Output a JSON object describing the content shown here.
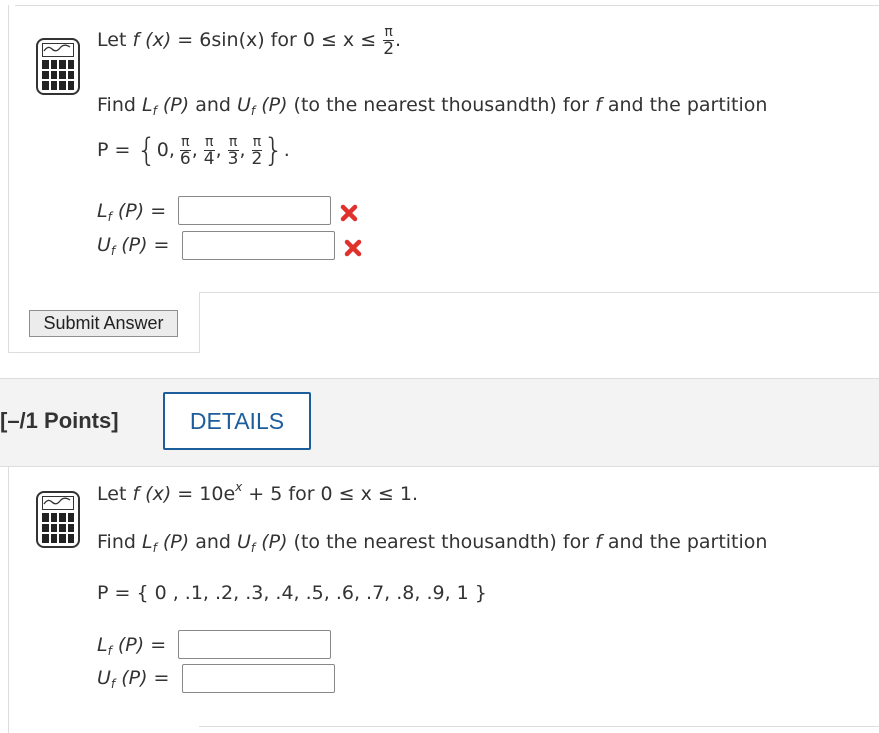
{
  "q1": {
    "let_text": "Let",
    "func": "f (x)",
    "equals": "=",
    "expr": "6sin(x) for 0 ≤ x ≤",
    "frac_num": "π",
    "frac_den": "2",
    "period": ".",
    "find_line": "(to the nearest thousandth) for",
    "find_prefix": "Find",
    "and": "and",
    "for_f": "f",
    "tail": "and the partition",
    "partition_label": "P =",
    "partition_first": "0,",
    "partition_fracs": [
      {
        "num": "π",
        "den": "6"
      },
      {
        "num": "π",
        "den": "4"
      },
      {
        "num": "π",
        "den": "3"
      },
      {
        "num": "π",
        "den": "2"
      }
    ],
    "lf_label": "L",
    "uf_label": "U",
    "sub_f": "f",
    "arg_p": "(P)",
    "lf_value": "",
    "uf_value": "",
    "lf_status": "incorrect",
    "uf_status": "incorrect",
    "submit_label": "Submit Answer"
  },
  "q2_header": {
    "points": "[–/1 Points]",
    "details_label": "DETAILS"
  },
  "q2": {
    "let_text": "Let",
    "func": "f (x)",
    "equals": "=",
    "expr_a": "10e",
    "expr_sup": "x",
    "expr_b": "+ 5 for 0 ≤ x ≤ 1.",
    "find_prefix": "Find",
    "and": "and",
    "find_line": "(to the nearest thousandth) for",
    "for_f": "f",
    "tail": "and the partition",
    "partition": "P = { 0 , .1, .2, .3, .4, .5, .6, .7, .8, .9, 1 }",
    "lf_label": "L",
    "uf_label": "U",
    "sub_f": "f",
    "arg_p": "(P)",
    "lf_value": "",
    "uf_value": ""
  },
  "colors": {
    "details_blue": "#1b5e9b",
    "error_red": "#e0312c"
  }
}
